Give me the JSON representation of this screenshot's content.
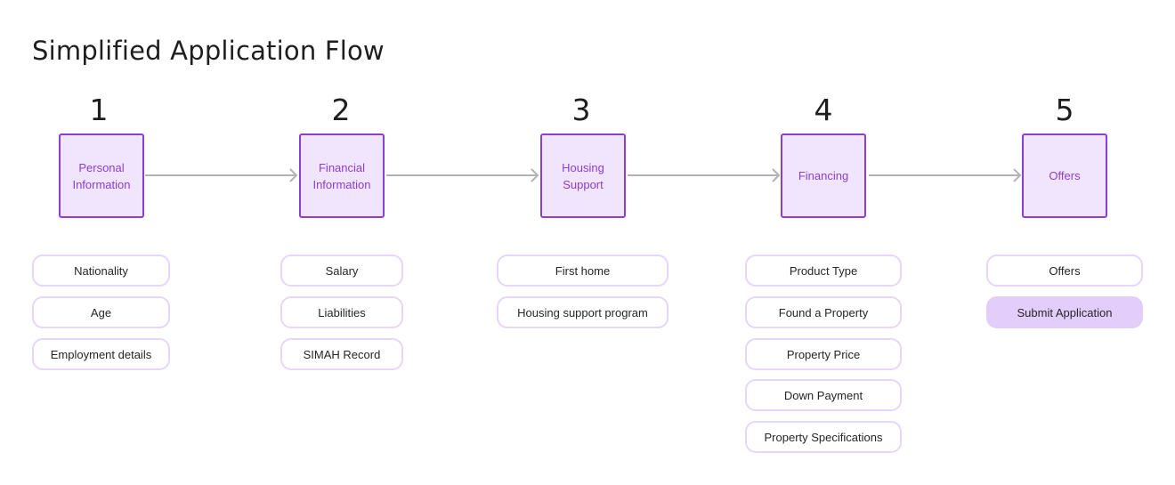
{
  "title": "Simplified Application Flow",
  "colors": {
    "accent": "#8a3fd1",
    "box_fill": "#f1e4fd",
    "pill_border": "#e6d6fb",
    "primary_pill_fill": "#e3cdfb",
    "arrow": "#b3b3b3"
  },
  "steps": [
    {
      "number": "1",
      "label": "Personal Information",
      "items": [
        "Nationality",
        "Age",
        "Employment details"
      ]
    },
    {
      "number": "2",
      "label": "Financial Information",
      "items": [
        "Salary",
        "Liabilities",
        "SIMAH Record"
      ]
    },
    {
      "number": "3",
      "label": "Housing Support",
      "items": [
        "First home",
        "Housing support program"
      ]
    },
    {
      "number": "4",
      "label": "Financing",
      "items": [
        "Product Type",
        "Found a Property",
        "Property Price",
        "Down Payment",
        "Property Specifications"
      ]
    },
    {
      "number": "5",
      "label": "Offers",
      "items": [
        "Offers"
      ],
      "action": "Submit Application"
    }
  ]
}
